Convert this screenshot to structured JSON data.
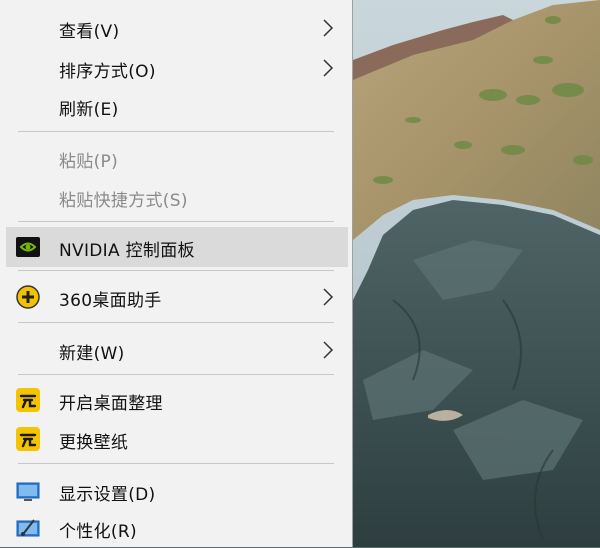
{
  "menu": {
    "view": "查看(V)",
    "sort_by": "排序方式(O)",
    "refresh": "刷新(E)",
    "paste": "粘贴(P)",
    "paste_shortcut": "粘贴快捷方式(S)",
    "nvidia": "NVIDIA 控制面板",
    "desk_helper": "360桌面助手",
    "new": "新建(W)",
    "organize": "开启桌面整理",
    "wallpaper": "更换壁纸",
    "display": "显示设置(D)",
    "personalize": "个性化(R)"
  },
  "icons": {
    "nvidia": "nvidia-icon",
    "desk_helper": "360-desk-helper-icon",
    "organize": "desk-organize-icon",
    "wallpaper": "change-wallpaper-icon",
    "display": "display-monitor-icon",
    "personalize": "personalize-icon",
    "submenu": "chevron-right-icon"
  },
  "colors": {
    "menu_background": "#f2f2f2",
    "hover_background": "#dadada",
    "disabled_text": "#8a8a8a",
    "separator": "#c8c8c8"
  }
}
